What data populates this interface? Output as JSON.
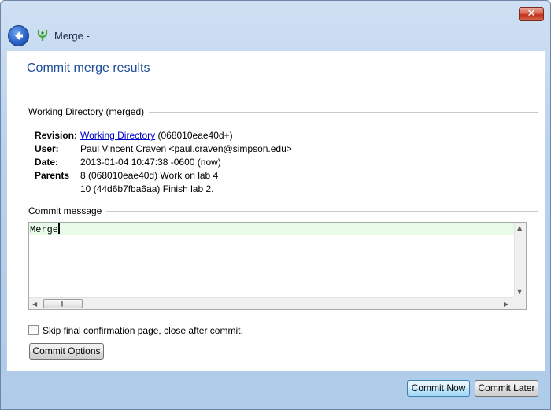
{
  "window": {
    "title": "Merge -",
    "close_symbol": "✕"
  },
  "heading": "Commit merge results",
  "working_directory": {
    "section_label": "Working Directory (merged)",
    "revision_key": "Revision:",
    "revision_link": "Working Directory",
    "revision_hash": "(068010eae40d+)",
    "user_key": "User:",
    "user_value": "Paul Vincent Craven <paul.craven@simpson.edu>",
    "date_key": "Date:",
    "date_value": "2013-01-04 10:47:38 -0600 (now)",
    "parents_key": "Parents",
    "parent1": "8 (068010eae40d) Work on lab 4",
    "parent2": "10 (44d6b7fba6aa) Finish lab 2."
  },
  "commit_message": {
    "section_label": "Commit message",
    "text": "Merge"
  },
  "skip_checkbox": {
    "label": "Skip final confirmation page, close after commit.",
    "checked": false
  },
  "buttons": {
    "commit_options": "Commit Options",
    "commit_now": "Commit Now",
    "commit_later": "Commit Later"
  },
  "colors": {
    "heading": "#1e4c9a",
    "link": "#0000cc",
    "message_highlight": "#e8fbe9"
  },
  "icons": {
    "back": "back-arrow-icon",
    "app": "merge-app-icon",
    "close": "close-icon"
  }
}
